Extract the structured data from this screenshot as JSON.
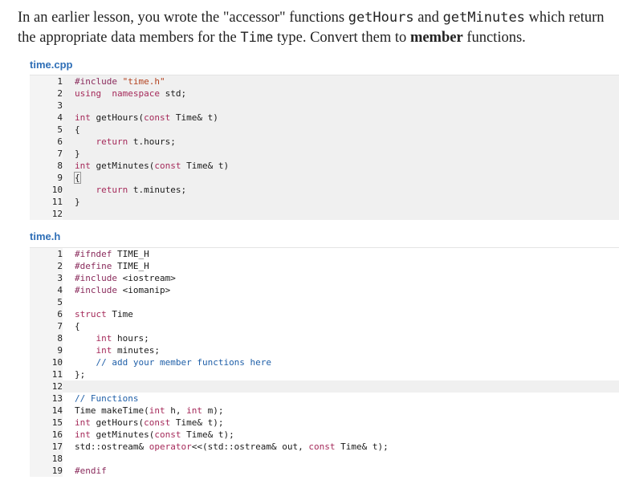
{
  "intro": {
    "t1": "In an earlier lesson, you wrote the \"accessor\" functions ",
    "c1": "getHours",
    "t2": " and ",
    "c2": "getMinutes",
    "t3": " which return the appropriate data members for the ",
    "c3": "Time",
    "t4": " type. Convert them to ",
    "b1": "member",
    "t5": " functions."
  },
  "files": [
    {
      "title": "time.cpp",
      "lines": [
        [
          [
            "pp",
            "#include "
          ],
          [
            "str",
            "\"time.h\""
          ]
        ],
        [
          [
            "kw",
            "using"
          ],
          [
            "",
            "  "
          ],
          [
            "kw",
            "namespace"
          ],
          [
            "",
            " std;"
          ]
        ],
        [],
        [
          [
            "kw",
            "int"
          ],
          [
            "",
            " getHours("
          ],
          [
            "kw",
            "const"
          ],
          [
            "",
            " Time& t)"
          ]
        ],
        [
          [
            "",
            "{"
          ]
        ],
        [
          [
            "",
            "    "
          ],
          [
            "kw",
            "return"
          ],
          [
            "",
            " t.hours;"
          ]
        ],
        [
          [
            "",
            "}"
          ]
        ],
        [
          [
            "kw",
            "int"
          ],
          [
            "",
            " getMinutes("
          ],
          [
            "kw",
            "const"
          ],
          [
            "",
            " Time& t)"
          ]
        ],
        [
          [
            "box",
            "{"
          ]
        ],
        [
          [
            "",
            "    "
          ],
          [
            "kw",
            "return"
          ],
          [
            "",
            " t.minutes;"
          ]
        ],
        [
          [
            "",
            "}"
          ]
        ],
        []
      ],
      "highlight": [
        0,
        1,
        2,
        3,
        4,
        5,
        6,
        7,
        8,
        9,
        10,
        11
      ]
    },
    {
      "title": "time.h",
      "lines": [
        [
          [
            "pp",
            "#ifndef"
          ],
          [
            "",
            " TIME_H"
          ]
        ],
        [
          [
            "pp",
            "#define"
          ],
          [
            "",
            " TIME_H"
          ]
        ],
        [
          [
            "pp",
            "#include"
          ],
          [
            "",
            " <iostream>"
          ]
        ],
        [
          [
            "pp",
            "#include"
          ],
          [
            "",
            " <iomanip>"
          ]
        ],
        [],
        [
          [
            "kw",
            "struct"
          ],
          [
            "",
            " Time"
          ]
        ],
        [
          [
            "",
            "{"
          ]
        ],
        [
          [
            "",
            "    "
          ],
          [
            "kw",
            "int"
          ],
          [
            "",
            " hours;"
          ]
        ],
        [
          [
            "",
            "    "
          ],
          [
            "kw",
            "int"
          ],
          [
            "",
            " minutes;"
          ]
        ],
        [
          [
            "",
            "    "
          ],
          [
            "cm",
            "// add your member functions here"
          ]
        ],
        [
          [
            "",
            "};"
          ]
        ],
        [],
        [
          [
            "cm",
            "// Functions"
          ]
        ],
        [
          [
            "",
            "Time makeTime("
          ],
          [
            "kw",
            "int"
          ],
          [
            "",
            " h, "
          ],
          [
            "kw",
            "int"
          ],
          [
            "",
            " m);"
          ]
        ],
        [
          [
            "kw",
            "int"
          ],
          [
            "",
            " getHours("
          ],
          [
            "kw",
            "const"
          ],
          [
            "",
            " Time& t);"
          ]
        ],
        [
          [
            "kw",
            "int"
          ],
          [
            "",
            " getMinutes("
          ],
          [
            "kw",
            "const"
          ],
          [
            "",
            " Time& t);"
          ]
        ],
        [
          [
            "",
            "std::ostream& "
          ],
          [
            "kw",
            "operator"
          ],
          [
            "",
            "<<(std::ostream& out, "
          ],
          [
            "kw",
            "const"
          ],
          [
            "",
            " Time& t);"
          ]
        ],
        [],
        [
          [
            "pp",
            "#endif"
          ]
        ]
      ],
      "highlight": [
        11
      ]
    }
  ]
}
